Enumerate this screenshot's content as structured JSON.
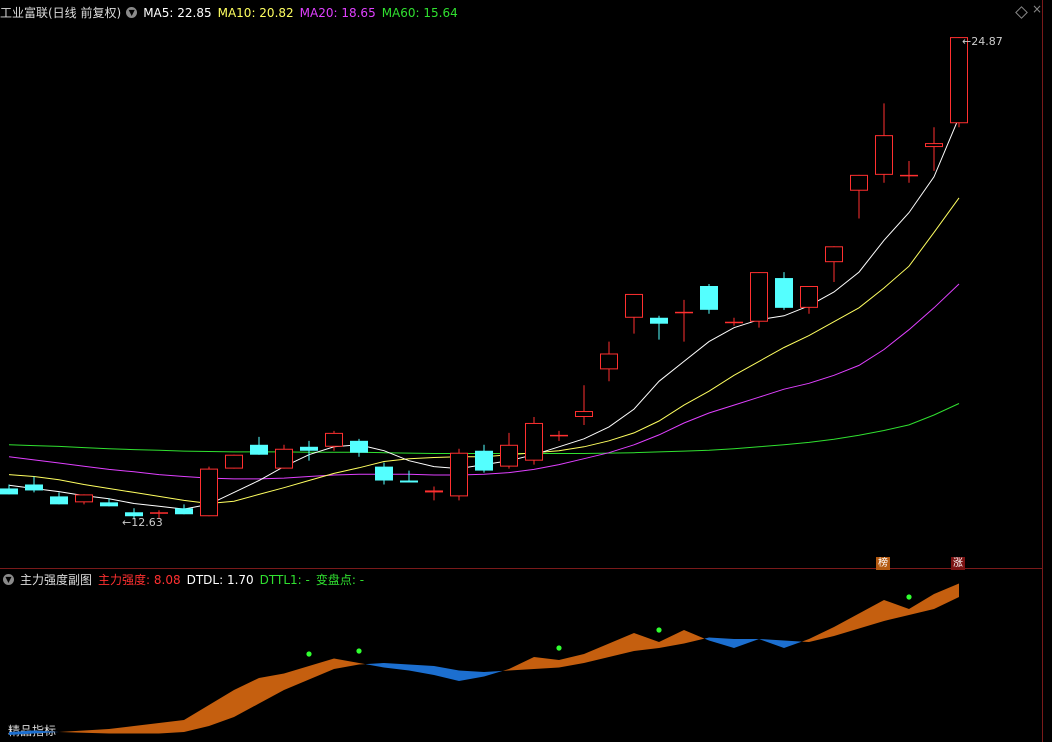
{
  "header": {
    "stock_title": "工业富联(日线 前复权)",
    "ma5": "MA5: 22.85",
    "ma10": "MA10: 20.82",
    "ma20": "MA20: 18.65",
    "ma60": "MA60: 15.64"
  },
  "sub_header": {
    "indicator_name": "主力强度副图",
    "strength": "主力强度: 8.08",
    "dtdl": "DTDL: 1.70",
    "dttl": "DTTL1: -",
    "turn_point": "变盘点: -"
  },
  "badges": {
    "bang": "榜",
    "zhang": "涨"
  },
  "footer": {
    "label": "精品指标"
  },
  "colors": {
    "up": "#ff3030",
    "down": "#54ffff",
    "ma5": "#ffffff",
    "ma10": "#ffff60",
    "ma20": "#e040ff",
    "ma60": "#30e030",
    "fill_up": "#c55f0f",
    "fill_down": "#1c6fd0",
    "dot": "#30ff30"
  },
  "chart_data": [
    {
      "type": "candlestick",
      "title": "工业富联(日线 前复权)",
      "ylim": [
        12.0,
        25.2
      ],
      "max_label": "24.87",
      "min_label": "12.63",
      "candles": [
        {
          "o": 13.5,
          "h": 13.6,
          "l": 13.35,
          "c": 13.35
        },
        {
          "o": 13.6,
          "h": 13.8,
          "l": 13.4,
          "c": 13.45
        },
        {
          "o": 13.3,
          "h": 13.4,
          "l": 13.1,
          "c": 13.1
        },
        {
          "o": 13.15,
          "h": 13.35,
          "l": 13.1,
          "c": 13.35
        },
        {
          "o": 13.15,
          "h": 13.25,
          "l": 13.05,
          "c": 13.05
        },
        {
          "o": 12.9,
          "h": 13.0,
          "l": 12.75,
          "c": 12.8
        },
        {
          "o": 12.9,
          "h": 12.95,
          "l": 12.75,
          "c": 12.9
        },
        {
          "o": 13.0,
          "h": 13.1,
          "l": 12.85,
          "c": 12.85
        },
        {
          "o": 12.8,
          "h": 14.05,
          "l": 12.8,
          "c": 14.0
        },
        {
          "o": 14.0,
          "h": 14.35,
          "l": 14.0,
          "c": 14.35
        },
        {
          "o": 14.6,
          "h": 14.8,
          "l": 14.35,
          "c": 14.35
        },
        {
          "o": 14.0,
          "h": 14.6,
          "l": 14.0,
          "c": 14.5
        },
        {
          "o": 14.55,
          "h": 14.7,
          "l": 14.2,
          "c": 14.45
        },
        {
          "o": 14.55,
          "h": 14.95,
          "l": 14.45,
          "c": 14.9
        },
        {
          "o": 14.7,
          "h": 14.75,
          "l": 14.3,
          "c": 14.4
        },
        {
          "o": 14.05,
          "h": 14.15,
          "l": 13.6,
          "c": 13.7
        },
        {
          "o": 13.7,
          "h": 13.95,
          "l": 13.65,
          "c": 13.65
        },
        {
          "o": 13.4,
          "h": 13.55,
          "l": 13.2,
          "c": 13.45
        },
        {
          "o": 13.3,
          "h": 14.5,
          "l": 13.2,
          "c": 14.4
        },
        {
          "o": 14.45,
          "h": 14.6,
          "l": 13.9,
          "c": 13.95
        },
        {
          "o": 14.05,
          "h": 14.9,
          "l": 14.0,
          "c": 14.6
        },
        {
          "o": 14.2,
          "h": 15.3,
          "l": 14.1,
          "c": 15.15
        },
        {
          "o": 14.85,
          "h": 14.95,
          "l": 14.7,
          "c": 14.85
        },
        {
          "o": 15.3,
          "h": 16.1,
          "l": 15.1,
          "c": 15.45
        },
        {
          "o": 16.5,
          "h": 17.2,
          "l": 16.2,
          "c": 16.9
        },
        {
          "o": 17.8,
          "h": 18.4,
          "l": 17.4,
          "c": 18.4
        },
        {
          "o": 17.8,
          "h": 17.85,
          "l": 17.25,
          "c": 17.65
        },
        {
          "o": 17.95,
          "h": 18.25,
          "l": 17.2,
          "c": 17.95
        },
        {
          "o": 18.6,
          "h": 18.65,
          "l": 17.9,
          "c": 18.0
        },
        {
          "o": 17.7,
          "h": 17.8,
          "l": 17.6,
          "c": 17.7
        },
        {
          "o": 17.7,
          "h": 18.95,
          "l": 17.55,
          "c": 18.95
        },
        {
          "o": 18.8,
          "h": 18.95,
          "l": 18.0,
          "c": 18.05
        },
        {
          "o": 18.05,
          "h": 18.6,
          "l": 17.9,
          "c": 18.6
        },
        {
          "o": 19.2,
          "h": 19.6,
          "l": 18.7,
          "c": 19.6
        },
        {
          "o": 21.0,
          "h": 21.4,
          "l": 20.3,
          "c": 21.4
        },
        {
          "o": 21.4,
          "h": 23.2,
          "l": 21.2,
          "c": 22.4
        },
        {
          "o": 21.4,
          "h": 21.75,
          "l": 21.2,
          "c": 21.4
        },
        {
          "o": 22.1,
          "h": 22.6,
          "l": 21.5,
          "c": 22.2
        },
        {
          "o": 22.7,
          "h": 24.87,
          "l": 22.6,
          "c": 24.87
        }
      ],
      "ma5": [
        13.58,
        13.5,
        13.42,
        13.32,
        13.24,
        13.12,
        13.05,
        12.98,
        13.1,
        13.4,
        13.7,
        14.05,
        14.35,
        14.55,
        14.6,
        14.45,
        14.2,
        14.05,
        14.0,
        14.1,
        14.2,
        14.35,
        14.55,
        14.75,
        15.05,
        15.5,
        16.2,
        16.7,
        17.2,
        17.55,
        17.75,
        17.85,
        18.1,
        18.45,
        18.95,
        19.75,
        20.45,
        21.35,
        22.85
      ],
      "ma10": [
        13.85,
        13.8,
        13.72,
        13.6,
        13.5,
        13.4,
        13.3,
        13.2,
        13.12,
        13.18,
        13.35,
        13.52,
        13.7,
        13.88,
        14.02,
        14.18,
        14.25,
        14.28,
        14.3,
        14.3,
        14.35,
        14.4,
        14.45,
        14.55,
        14.7,
        14.9,
        15.2,
        15.6,
        15.95,
        16.35,
        16.7,
        17.05,
        17.35,
        17.7,
        18.05,
        18.55,
        19.1,
        19.95,
        20.82
      ],
      "ma20": [
        14.3,
        14.22,
        14.14,
        14.06,
        13.98,
        13.92,
        13.85,
        13.8,
        13.76,
        13.74,
        13.74,
        13.76,
        13.8,
        13.84,
        13.86,
        13.86,
        13.86,
        13.84,
        13.84,
        13.86,
        13.9,
        13.98,
        14.1,
        14.25,
        14.4,
        14.6,
        14.85,
        15.15,
        15.4,
        15.6,
        15.8,
        16.0,
        16.15,
        16.35,
        16.6,
        17.0,
        17.5,
        18.05,
        18.65
      ],
      "ma60": [
        14.6,
        14.58,
        14.56,
        14.53,
        14.5,
        14.48,
        14.46,
        14.44,
        14.43,
        14.42,
        14.42,
        14.42,
        14.41,
        14.41,
        14.41,
        14.4,
        14.39,
        14.38,
        14.38,
        14.38,
        14.38,
        14.38,
        14.38,
        14.38,
        14.39,
        14.4,
        14.42,
        14.44,
        14.46,
        14.5,
        14.55,
        14.6,
        14.66,
        14.74,
        14.84,
        14.96,
        15.1,
        15.35,
        15.64
      ]
    },
    {
      "type": "area",
      "title": "主力强度副图",
      "ylim": [
        0,
        10
      ],
      "strength": [
        0.2,
        0.3,
        0.4,
        0.5,
        0.6,
        0.8,
        1.0,
        1.2,
        2.2,
        3.2,
        4.0,
        4.3,
        4.8,
        5.3,
        5.0,
        4.7,
        4.5,
        4.2,
        3.8,
        4.1,
        4.6,
        5.4,
        5.2,
        5.6,
        6.3,
        7.0,
        6.4,
        7.2,
        6.5,
        6.0,
        6.6,
        6.0,
        6.6,
        7.4,
        8.3,
        9.2,
        8.6,
        9.6,
        10.3
      ],
      "dtdl": [
        0.4,
        0.5,
        0.4,
        0.35,
        0.3,
        0.3,
        0.3,
        0.4,
        0.8,
        1.4,
        2.3,
        3.2,
        3.9,
        4.6,
        4.9,
        5.0,
        4.9,
        4.8,
        4.5,
        4.4,
        4.5,
        4.6,
        4.7,
        5.0,
        5.4,
        5.8,
        6.0,
        6.3,
        6.7,
        6.6,
        6.6,
        6.5,
        6.4,
        6.8,
        7.3,
        7.8,
        8.2,
        8.6,
        9.4
      ],
      "signal_points": [
        12,
        14,
        22,
        26,
        36
      ]
    }
  ]
}
